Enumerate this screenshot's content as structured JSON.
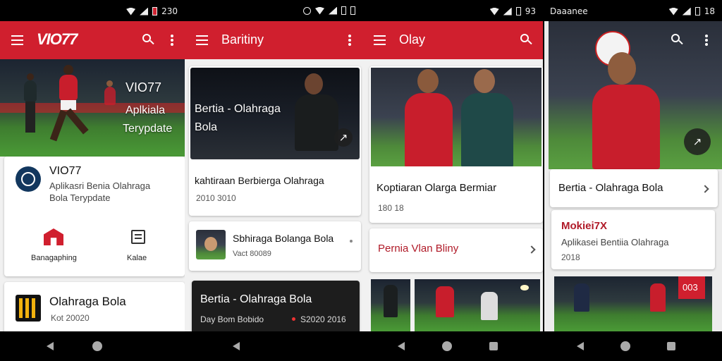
{
  "screen1": {
    "status_time": "230",
    "logo": "VIO77",
    "hero": {
      "title": "VIO77",
      "line1": "Aplkiala",
      "line2": "Terypdate"
    },
    "app_card": {
      "name": "VIO77",
      "desc_line1": "Aplikasri Benia Olahraga",
      "desc_line2": "Bola Terypdate"
    },
    "actions": [
      {
        "label": "Banagaphing",
        "icon": "home-icon"
      },
      {
        "label": "Kalae",
        "icon": "news-icon"
      }
    ],
    "list_item": {
      "title": "Olahraga Bola",
      "subtitle": "Kot 20020"
    }
  },
  "screen2": {
    "title": "Baritiny",
    "hero": {
      "line1": "Bertia - Olahraga",
      "line2": "Bola"
    },
    "article": {
      "title": "kahtiraan Berbierga Olahraga",
      "meta": "2010 3010"
    },
    "row": {
      "title": "Sbhiraga Bolanga Bola",
      "meta": "Vact 80089"
    },
    "dark_card": {
      "title": "Bertia - Olahraga Bola",
      "meta_left": "Day Bom Bobido",
      "meta_right": "S2020 2016"
    }
  },
  "screen3": {
    "status_time": "93",
    "title": "Olay",
    "article": {
      "title": "Koptiaran Olarga Bermiar",
      "meta": "180 18"
    },
    "link": {
      "title": "Pernia Vlan Bliny"
    }
  },
  "screen4": {
    "status_left": "Daaanee",
    "status_time": "18",
    "headline": "Bertia - Olahraga Bola",
    "promo": {
      "title": "Mokiei7X",
      "desc": "Aplikasei Bentiia Olahraga",
      "meta": "2018"
    },
    "badge": "003"
  },
  "colors": {
    "brand_red": "#d01f2e"
  }
}
